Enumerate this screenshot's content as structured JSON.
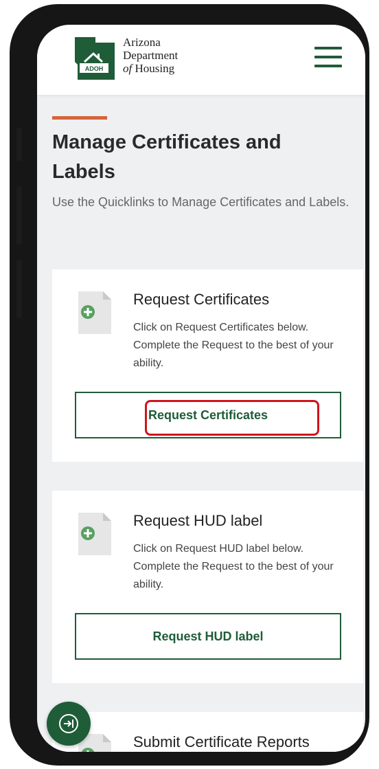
{
  "header": {
    "logo": {
      "mark_text": "ADOH",
      "line1": "Arizona",
      "line2": "Department",
      "line3_italic": "of",
      "line3": "Housing"
    },
    "menu_icon": "hamburger-menu-icon"
  },
  "page": {
    "title": "Manage Certificates and Labels",
    "subtitle": "Use the Quicklinks to Manage Certificates and Labels."
  },
  "cards": [
    {
      "title": "Request Certificates",
      "description": "Click on Request Certificates below. Complete the Request to the best of your ability.",
      "button_label": "Request Certificates",
      "highlighted": true
    },
    {
      "title": "Request HUD label",
      "description": "Click on Request HUD label below. Complete the Request to the best of your ability.",
      "button_label": "Request HUD label",
      "highlighted": false
    },
    {
      "title": "Submit Certificate Reports"
    }
  ],
  "fab": {
    "icon": "arrow-to-right-icon"
  },
  "colors": {
    "brand_green": "#1f5c38",
    "accent_orange": "#d4653a",
    "highlight_red": "#d0141c",
    "page_background": "#eef0f2"
  }
}
